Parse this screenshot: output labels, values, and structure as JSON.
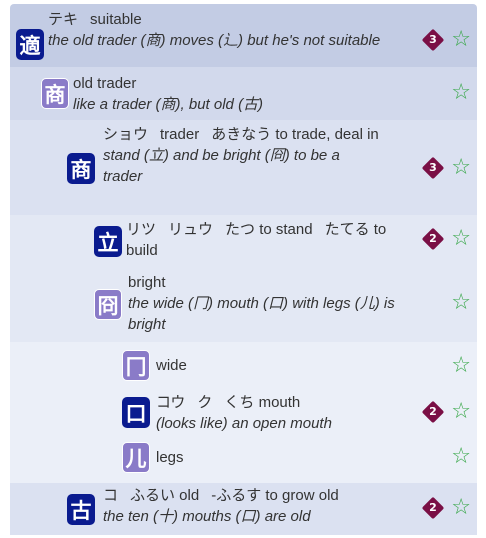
{
  "entries": [
    {
      "kanji": "適",
      "style": "navy",
      "head": [
        "テキ",
        "suitable"
      ],
      "meaning": "the old trader (商) moves (辶) but he's not suitable",
      "badge": "3"
    },
    {
      "kanji": "商",
      "style": "purple",
      "head": [
        "old trader"
      ],
      "meaning": "like a trader (商), but old (古)",
      "badge": ""
    },
    {
      "kanji": "商",
      "style": "navy",
      "head": [
        "ショウ",
        "trader",
        "あきなう to trade, deal in"
      ],
      "meaning": "stand (立) and be bright (冏) to be a trader",
      "badge": "3"
    },
    {
      "kanji": "立",
      "style": "navy",
      "head": [
        "リツ",
        "リュウ",
        "たつ to stand",
        "たてる to build"
      ],
      "meaning": "",
      "badge": "2"
    },
    {
      "kanji": "冏",
      "style": "purple",
      "head": [
        "bright"
      ],
      "meaning": "the wide (冂) mouth (口) with legs (儿) is bright",
      "badge": ""
    },
    {
      "kanji": "冂",
      "style": "purple",
      "head": [
        "wide"
      ],
      "meaning": "",
      "badge": ""
    },
    {
      "kanji": "口",
      "style": "navy",
      "head": [
        "コウ",
        "ク",
        "くち mouth"
      ],
      "meaning": "(looks like) an open mouth",
      "badge": "2"
    },
    {
      "kanji": "儿",
      "style": "purple",
      "head": [
        "legs"
      ],
      "meaning": "",
      "badge": ""
    },
    {
      "kanji": "古",
      "style": "navy",
      "head": [
        "コ",
        "ふるい old",
        "-ふるす to grow old"
      ],
      "meaning": "the ten (十) mouths (口) are old",
      "badge": "2"
    }
  ],
  "icons": {
    "favorite": "star-outline-icon",
    "count_badge": "diamond-badge"
  },
  "colors": {
    "navy": "#0a1b8f",
    "purple": "#8a7bc8",
    "badge": "#7a0f45",
    "star": "#3aa84a"
  }
}
